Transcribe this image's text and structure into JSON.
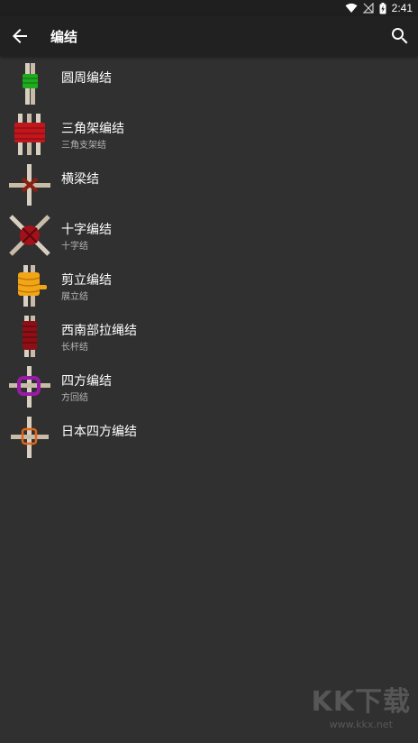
{
  "status_bar": {
    "time": "2:41",
    "icons": [
      "wifi-icon",
      "no-signal-icon",
      "battery-charging-icon"
    ]
  },
  "app_bar": {
    "title": "编结",
    "back_icon": "arrow-back-icon",
    "search_icon": "search-icon"
  },
  "knots": [
    {
      "title": "圆周编结",
      "subtitle": "",
      "color": "#1faa1f"
    },
    {
      "title": "三角架编结",
      "subtitle": "三角支架结",
      "color": "#c0161c"
    },
    {
      "title": "横梁结",
      "subtitle": "",
      "color": "#8a1f12"
    },
    {
      "title": "十字编结",
      "subtitle": "十字结",
      "color": "#a1121a"
    },
    {
      "title": "剪立编结",
      "subtitle": "展立结",
      "color": "#f2a516"
    },
    {
      "title": "西南部拉绳结",
      "subtitle": "长杆结",
      "color": "#8e1017"
    },
    {
      "title": "四方编结",
      "subtitle": "方回结",
      "color": "#9a1aa8"
    },
    {
      "title": "日本四方编结",
      "subtitle": "",
      "color": "#e0661a"
    }
  ],
  "watermark": {
    "big": "KK下载",
    "small": "www.kkx.net"
  }
}
